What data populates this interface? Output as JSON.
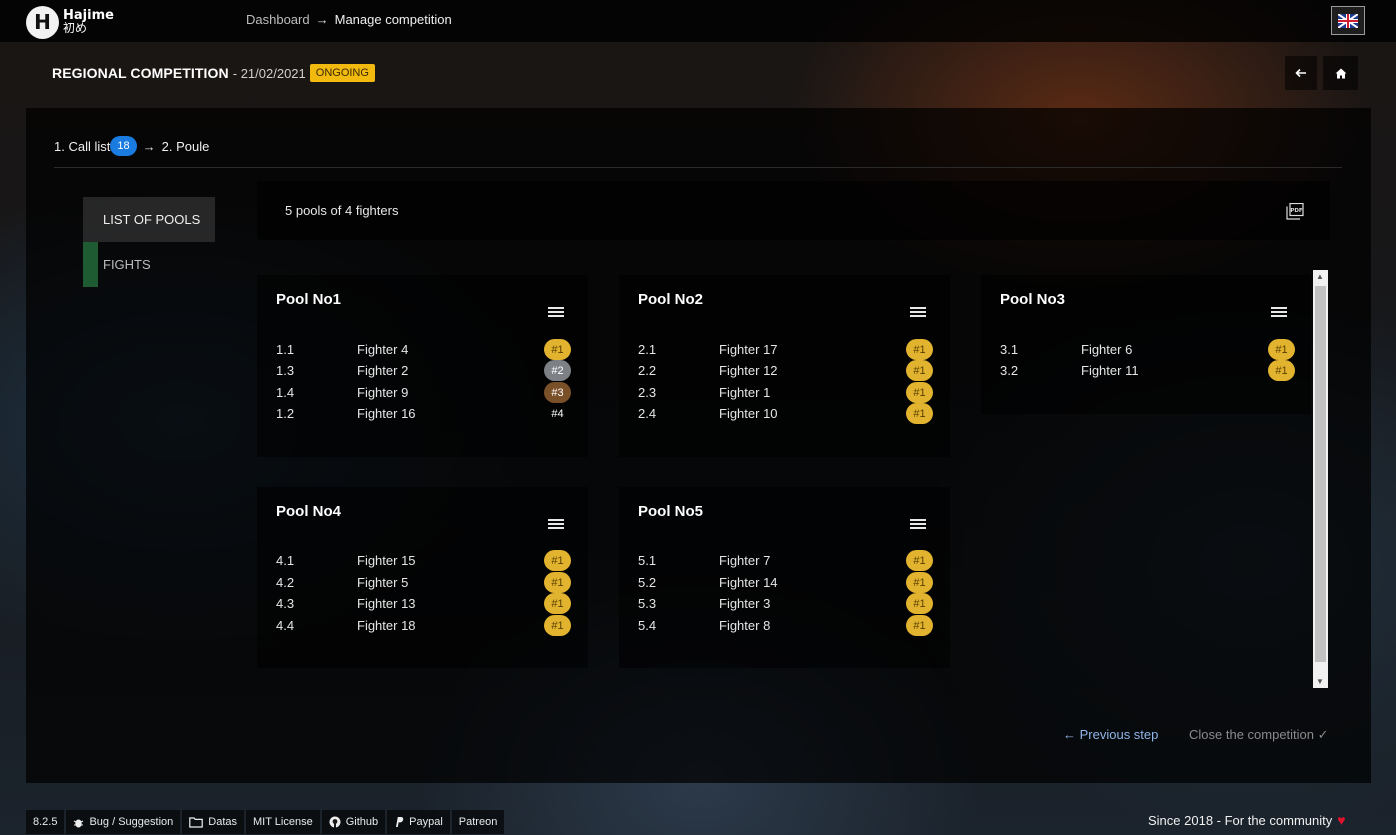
{
  "app": {
    "logo_text": "Hajime",
    "logo_subtext": "初め"
  },
  "breadcrumb": {
    "link": "Dashboard",
    "arrow": "→",
    "current": "Manage competition"
  },
  "competition": {
    "title": "REGIONAL COMPETITION",
    "date": "- 21/02/2021",
    "status": "ONGOING"
  },
  "steps": {
    "step1": "1. Call list",
    "call_count": "18",
    "arrow": "→",
    "step2": "2. Poule"
  },
  "sidebar": {
    "items": [
      {
        "label": "LIST OF POOLS"
      },
      {
        "label": "FIGHTS"
      }
    ]
  },
  "summary": "5 pools of 4 fighters",
  "pools": [
    {
      "title": "Pool No1",
      "fighters": [
        {
          "num": "1.1",
          "name": "Fighter 4",
          "rank": "#1"
        },
        {
          "num": "1.3",
          "name": "Fighter 2",
          "rank": "#2"
        },
        {
          "num": "1.4",
          "name": "Fighter 9",
          "rank": "#3"
        },
        {
          "num": "1.2",
          "name": "Fighter 16",
          "rank": "#4"
        }
      ]
    },
    {
      "title": "Pool No2",
      "fighters": [
        {
          "num": "2.1",
          "name": "Fighter 17",
          "rank": "#1"
        },
        {
          "num": "2.2",
          "name": "Fighter 12",
          "rank": "#1"
        },
        {
          "num": "2.3",
          "name": "Fighter 1",
          "rank": "#1"
        },
        {
          "num": "2.4",
          "name": "Fighter 10",
          "rank": "#1"
        }
      ]
    },
    {
      "title": "Pool No3",
      "fighters": [
        {
          "num": "3.1",
          "name": "Fighter 6",
          "rank": "#1"
        },
        {
          "num": "3.2",
          "name": "Fighter 11",
          "rank": "#1"
        }
      ]
    },
    {
      "title": "Pool No4",
      "fighters": [
        {
          "num": "4.1",
          "name": "Fighter 15",
          "rank": "#1"
        },
        {
          "num": "4.2",
          "name": "Fighter 5",
          "rank": "#1"
        },
        {
          "num": "4.3",
          "name": "Fighter 13",
          "rank": "#1"
        },
        {
          "num": "4.4",
          "name": "Fighter 18",
          "rank": "#1"
        }
      ]
    },
    {
      "title": "Pool No5",
      "fighters": [
        {
          "num": "5.1",
          "name": "Fighter 7",
          "rank": "#1"
        },
        {
          "num": "5.2",
          "name": "Fighter 14",
          "rank": "#1"
        },
        {
          "num": "5.3",
          "name": "Fighter 3",
          "rank": "#1"
        },
        {
          "num": "5.4",
          "name": "Fighter 8",
          "rank": "#1"
        }
      ]
    }
  ],
  "actions": {
    "previous": "← Previous step",
    "close": "Close the competition ✓"
  },
  "footer": {
    "version": "8.2.5",
    "bug": "Bug / Suggestion",
    "datas": "Datas",
    "license": "MIT License",
    "github": "Github",
    "paypal": "Paypal",
    "patreon": "Patreon",
    "tagline": "Since 2018 - For the community"
  },
  "colors": {
    "status_badge": "#f2b90f",
    "count_badge": "#1a7be0",
    "rank_gold": "#e2b32e",
    "rank_silver": "#7d8186",
    "rank_bronze": "#7a5028",
    "fights_marker": "#1e5a32",
    "heart": "#e0132d"
  },
  "icons": [
    "back-arrow-icon",
    "home-icon",
    "pdf-icon",
    "list-icon",
    "bug-icon",
    "folder-icon",
    "github-icon",
    "paypal-icon",
    "heart-icon",
    "uk-flag-icon"
  ]
}
